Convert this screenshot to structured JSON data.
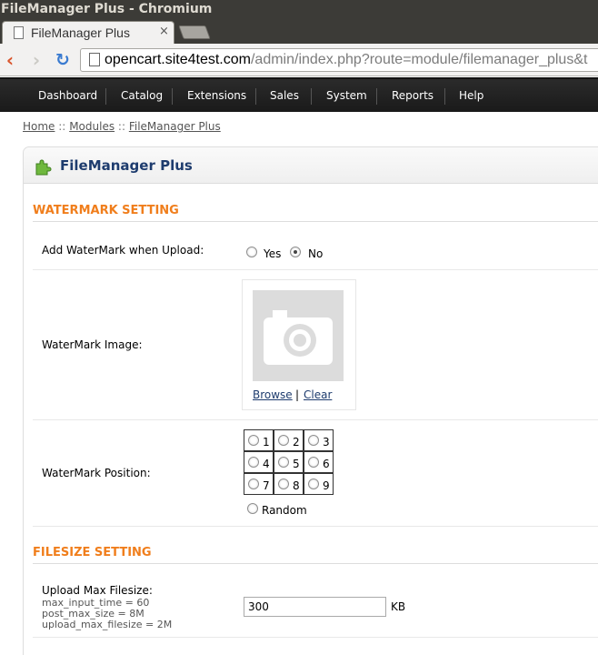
{
  "window": {
    "title": "FileManager Plus - Chromium"
  },
  "tab": {
    "label": "FileManager Plus",
    "close": "×"
  },
  "toolbar": {
    "url_host": "opencart.site4test.com",
    "url_path": "/admin/index.php?route=module/filemanager_plus&t"
  },
  "menu": {
    "items": [
      "Dashboard",
      "Catalog",
      "Extensions",
      "Sales",
      "System",
      "Reports",
      "Help"
    ]
  },
  "breadcrumb": {
    "home": "Home",
    "sep": "::",
    "modules": "Modules",
    "current": "FileManager Plus"
  },
  "box": {
    "title": "FileManager Plus"
  },
  "watermark": {
    "section_title": "WATERMARK SETTING",
    "add_label": "Add WaterMark when Upload:",
    "yes": "Yes",
    "no": "No",
    "selected": "No",
    "image_label": "WaterMark Image:",
    "browse": "Browse",
    "pipe": "|",
    "clear": "Clear",
    "position_label": "WaterMark Position:",
    "positions": [
      "1",
      "2",
      "3",
      "4",
      "5",
      "6",
      "7",
      "8",
      "9"
    ],
    "random": "Random"
  },
  "filesize": {
    "section_title": "FILESIZE SETTING",
    "label": "Upload Max Filesize:",
    "max_input_time": "max_input_time = 60",
    "post_max_size": "post_max_size = 8M",
    "upload_max_filesize": "upload_max_filesize = 2M",
    "value": "300",
    "unit": "KB"
  }
}
